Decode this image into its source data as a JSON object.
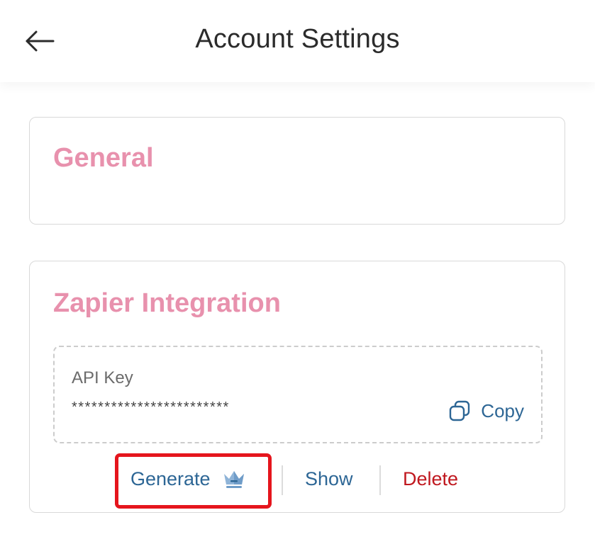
{
  "header": {
    "title": "Account Settings",
    "back_icon": "arrow-left-icon"
  },
  "sections": {
    "general": {
      "title": "General"
    },
    "zapier": {
      "title": "Zapier Integration",
      "api_key": {
        "label": "API Key",
        "masked_value": "************************",
        "copy_label": "Copy",
        "copy_icon": "copy-icon"
      },
      "actions": {
        "generate_label": "Generate",
        "premium_icon": "crown-icon",
        "show_label": "Show",
        "delete_label": "Delete"
      }
    }
  },
  "colors": {
    "section_title": "#e891ad",
    "link_blue": "#2d6695",
    "delete_red": "#c0181f",
    "highlight_red": "#e5151d"
  }
}
